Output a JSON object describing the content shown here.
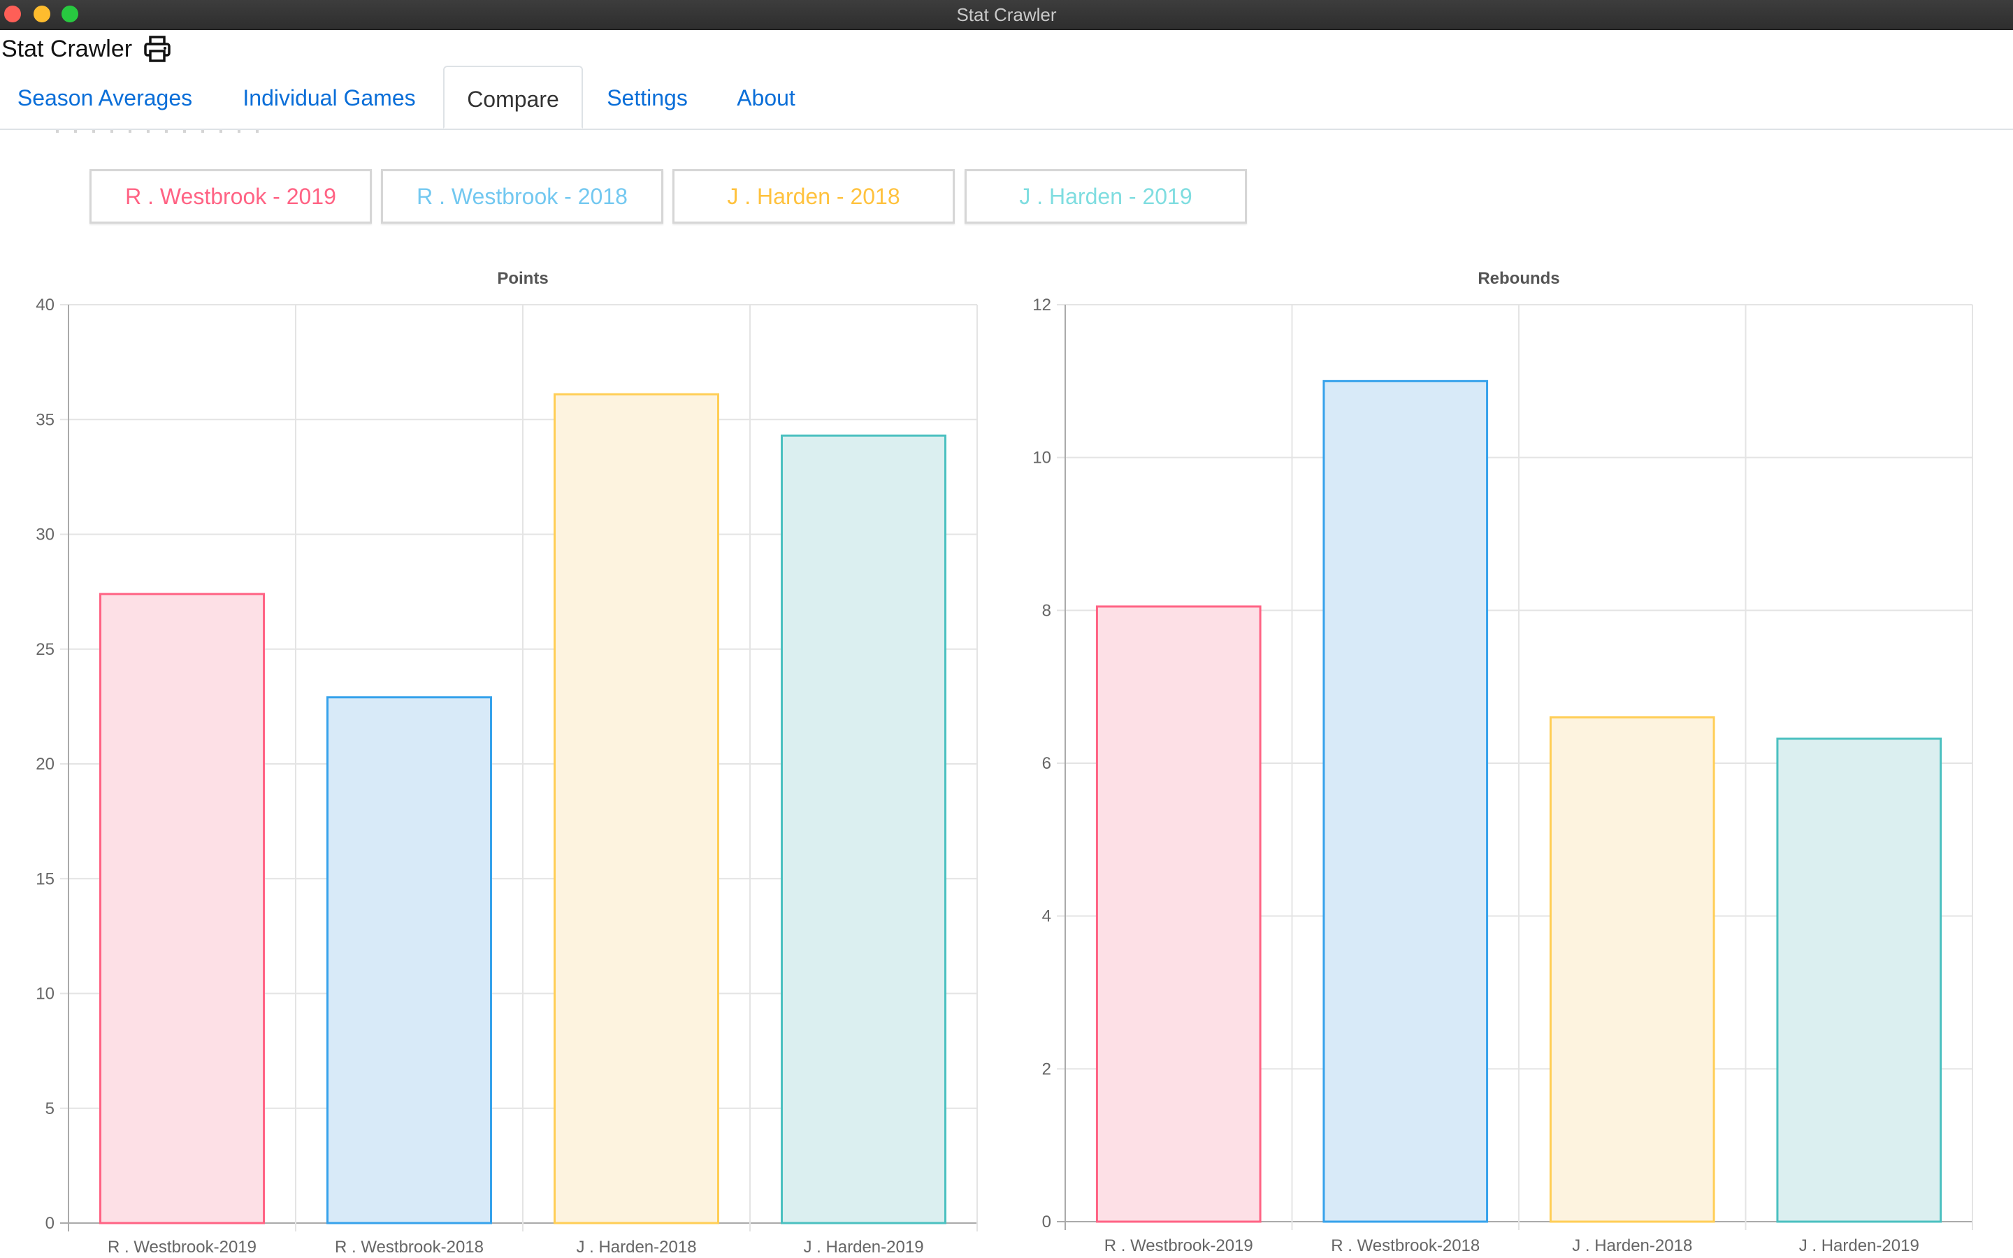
{
  "window": {
    "title": "Stat Crawler"
  },
  "app": {
    "title": "Stat Crawler",
    "print_icon": "printer-icon"
  },
  "tabs": [
    {
      "label": "Season Averages",
      "active": false
    },
    {
      "label": "Individual Games",
      "active": false
    },
    {
      "label": "Compare",
      "active": true
    },
    {
      "label": "Settings",
      "active": false
    },
    {
      "label": "About",
      "active": false
    }
  ],
  "players": [
    {
      "label": "R . Westbrook - 2019",
      "color": "#ff6384"
    },
    {
      "label": "R . Westbrook - 2018",
      "color": "#73c8f0"
    },
    {
      "label": "J . Harden - 2018",
      "color": "#ffc23e"
    },
    {
      "label": "J . Harden - 2019",
      "color": "#7fdde0"
    }
  ],
  "colors": {
    "tab_link": "#0a6ed8",
    "series_fill": [
      "#fde0e6",
      "#d8eaf8",
      "#fdf3df",
      "#dbeff0"
    ],
    "series_stroke": [
      "#ff6384",
      "#36a2eb",
      "#ffce56",
      "#4bc0c0"
    ]
  },
  "chart_data": [
    {
      "type": "bar",
      "title": "Points",
      "categories": [
        "R . Westbrook-2019",
        "R . Westbrook-2018",
        "J . Harden-2018",
        "J . Harden-2019"
      ],
      "values": [
        27.4,
        22.9,
        36.1,
        34.3
      ],
      "ylim": [
        0,
        40
      ],
      "yticks": [
        0,
        5,
        10,
        15,
        20,
        25,
        30,
        35,
        40
      ],
      "grid": true
    },
    {
      "type": "bar",
      "title": "Rebounds",
      "categories": [
        "R . Westbrook-2019",
        "R . Westbrook-2018",
        "J . Harden-2018",
        "J . Harden-2019"
      ],
      "values": [
        8.05,
        11.0,
        6.6,
        6.32
      ],
      "ylim": [
        0,
        12
      ],
      "yticks": [
        0,
        2,
        4,
        6,
        8,
        10,
        12
      ],
      "grid": true
    }
  ]
}
